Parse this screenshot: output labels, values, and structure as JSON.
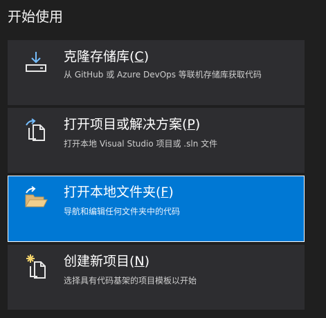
{
  "section": {
    "title": "开始使用"
  },
  "cards": [
    {
      "id": "clone",
      "title_main": "克隆存储库(",
      "access_key": "C",
      "title_end": ")",
      "description": "从 GitHub 或 Azure DevOps 等联机存储库获取代码",
      "icon": "download-drive-icon",
      "selected": false
    },
    {
      "id": "open-project",
      "title_main": "打开项目或解决方案(",
      "access_key": "P",
      "title_end": ")",
      "description": "打开本地 Visual Studio 项目或 .sln 文件",
      "icon": "open-file-icon",
      "selected": false
    },
    {
      "id": "open-folder",
      "title_main": "打开本地文件夹(",
      "access_key": "F",
      "title_end": ")",
      "description": "导航和编辑任何文件夹中的代码",
      "icon": "open-folder-icon",
      "selected": true
    },
    {
      "id": "new-project",
      "title_main": "创建新项目(",
      "access_key": "N",
      "title_end": ")",
      "description": "选择具有代码基架的项目模板以开始",
      "icon": "new-project-icon",
      "selected": false
    }
  ],
  "colors": {
    "background": "#1f1f1f",
    "card": "#2d2d30",
    "selected": "#0078d4",
    "icon_accent": "#75beff",
    "folder": "#dcb67a",
    "star": "#f4d36b"
  }
}
